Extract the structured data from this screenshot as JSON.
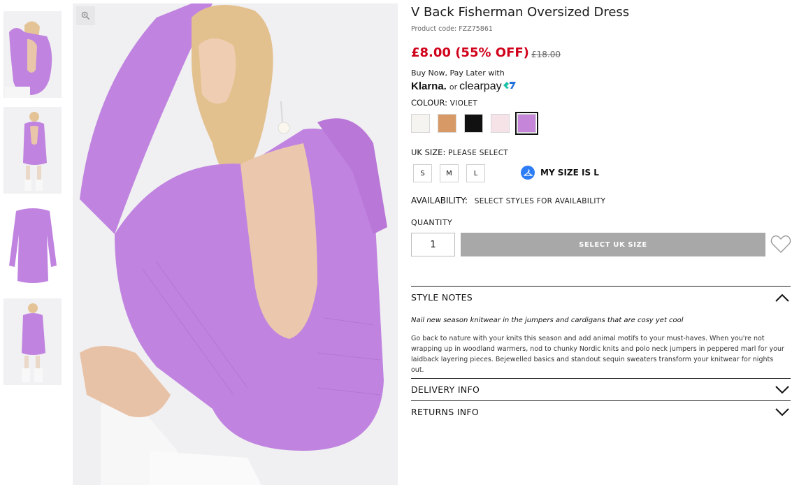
{
  "product": {
    "title": "V Back Fisherman Oversized Dress",
    "code": "Product code: FZZ75861"
  },
  "price": {
    "current": "£8.00 (55% OFF)",
    "was": "£18.00"
  },
  "bnpl": {
    "text": "Buy Now, Pay Later with",
    "klarna": "Klarna.",
    "or": "or",
    "clearpay": "clearpay"
  },
  "colour": {
    "label": "COLOUR:",
    "selected": "VIOLET",
    "swatches": [
      {
        "name": "white",
        "hex": "#f5f4f1"
      },
      {
        "name": "camel",
        "hex": "#d79a66"
      },
      {
        "name": "black",
        "hex": "#111111"
      },
      {
        "name": "pink",
        "hex": "#f6e3e8"
      },
      {
        "name": "violet",
        "hex": "#c586d9"
      }
    ]
  },
  "size": {
    "label": "UK SIZE:",
    "prompt": "PLEASE SELECT",
    "options": [
      "S",
      "M",
      "L"
    ],
    "my_size": "MY SIZE IS L"
  },
  "availability": {
    "label": "AVAILABILITY:",
    "value": "SELECT STYLES FOR AVAILABILITY"
  },
  "quantity": {
    "label": "QUANTITY",
    "value": "1"
  },
  "cta": {
    "label": "SELECT UK SIZE"
  },
  "style_notes": {
    "title": "STYLE NOTES",
    "intro": "Nail new season knitwear in the jumpers and cardigans that are cosy yet cool",
    "body": "Go back to nature with your knits this season and add animal motifs to your must-haves. When you're not wrapping up in woodland warmers, nod to chunky Nordic knits and polo neck jumpers in peppered marl for your laidback layering pieces. Bejewelled basics and standout sequin sweaters transform your knitwear for nights out."
  },
  "delivery": {
    "title": "DELIVERY INFO"
  },
  "returns": {
    "title": "RETURNS INFO"
  },
  "icons": {
    "zoom": "zoom-icon",
    "wishlist": "heart-icon",
    "hanger": "hanger-icon",
    "chevron_up": "chevron-up-icon",
    "chevron_down": "chevron-down-icon"
  },
  "colors": {
    "sale_red": "#d0021b",
    "dress_violet": "#c084e0",
    "disabled_button": "#a8a8a8",
    "size_assistant_blue": "#2d7df6"
  }
}
